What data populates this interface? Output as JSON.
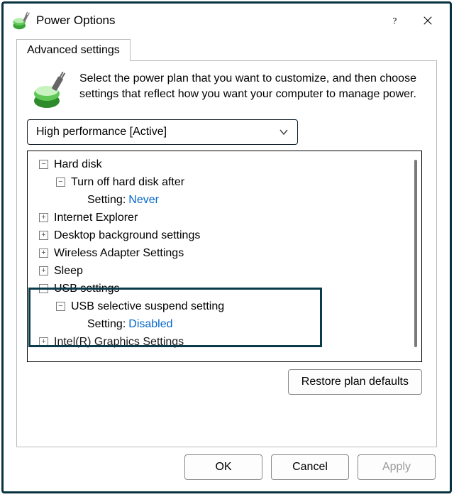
{
  "title": "Power Options",
  "tab_label": "Advanced settings",
  "intro_text": "Select the power plan that you want to customize, and then choose settings that reflect how you want your computer to manage power.",
  "plan_selector": "High performance [Active]",
  "tree": {
    "n0": {
      "label": "Hard disk"
    },
    "n0_0": {
      "label": "Turn off hard disk after"
    },
    "n0_0_setting_label": "Setting:",
    "n0_0_setting_value": "Never",
    "n1": {
      "label": "Internet Explorer"
    },
    "n2": {
      "label": "Desktop background settings"
    },
    "n3": {
      "label": "Wireless Adapter Settings"
    },
    "n4": {
      "label": "Sleep"
    },
    "n5": {
      "label": "USB settings"
    },
    "n5_0": {
      "label": "USB selective suspend setting"
    },
    "n5_0_setting_label": "Setting:",
    "n5_0_setting_value": "Disabled",
    "n6": {
      "label": "Intel(R) Graphics Settings"
    }
  },
  "restore_label": "Restore plan defaults",
  "buttons": {
    "ok": "OK",
    "cancel": "Cancel",
    "apply": "Apply"
  }
}
